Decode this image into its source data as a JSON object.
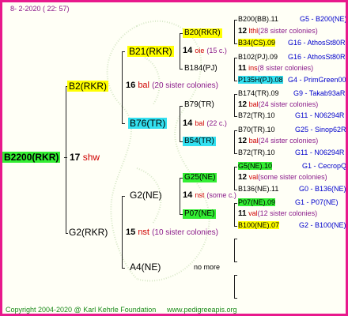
{
  "header": {
    "date": "8-  2-2020 ( 22: 57)"
  },
  "root": {
    "label": "B2200(RKR)",
    "count": "17",
    "place": "shw"
  },
  "gen1": {
    "top": {
      "label": "B2(RKR)",
      "count": "16",
      "place": "bal",
      "sister": "(20 sister colonies)"
    },
    "bottom": {
      "label": "G2(RKR)",
      "count": "15",
      "place": "nst",
      "sister": "(10 sister colonies)"
    }
  },
  "gen2": {
    "b21": {
      "label": "B21(RKR)",
      "count": "14",
      "place": "oie",
      "sister": "(15 c.)"
    },
    "b76": {
      "label": "B76(TR)",
      "count": "14",
      "place": "bal",
      "sister": "(22 c.)"
    },
    "g2": {
      "label": "G2(NE)",
      "count": "14",
      "place": "nst",
      "sister": "(some c.)"
    },
    "a4": {
      "label": "A4(NE)",
      "nomore": "no more"
    }
  },
  "gen3": {
    "b20": "B20(RKR)",
    "b184": "B184(PJ)",
    "b79": "B79(TR)",
    "b54": "B54(TR)",
    "g25": "G25(NE)",
    "p07": "P07(NE)"
  },
  "gen4": {
    "r1": {
      "name": "B200(BB).11",
      "id": "G5 - B200(NE)"
    },
    "r2": {
      "count": "12",
      "place": "lthl",
      "sister": "(28 sister colonies)"
    },
    "r3": {
      "name": "B34(CS).09",
      "id": "G16 - AthosSt80R"
    },
    "r4": {
      "name": "B102(PJ).09",
      "id": "G16 - AthosSt80R"
    },
    "r5": {
      "count": "11",
      "place": "ins",
      "sister": "(8 sister colonies)"
    },
    "r6": {
      "name": "P135H(PJ).08",
      "id": "G4 - PrimGreen00"
    },
    "r7": {
      "name": "B174(TR).09",
      "id": "G9 - Takab93aR"
    },
    "r8": {
      "count": "12",
      "place": "bal",
      "sister": "(24 sister colonies)"
    },
    "r9": {
      "name": "B72(TR).10",
      "id": "G11 - N06294R"
    },
    "r10": {
      "name": "B70(TR).10",
      "id": "G25 - Sinop62R"
    },
    "r11": {
      "count": "12",
      "place": "bal",
      "sister": "(24 sister colonies)"
    },
    "r12": {
      "name": "B72(TR).10",
      "id": "G11 - N06294R"
    },
    "r13": {
      "name": "G5(NE).10",
      "id": "G1 - CecropQ"
    },
    "r14": {
      "count": "12",
      "place": "val",
      "sister": "(some sister colonies)"
    },
    "r15": {
      "name": "B136(NE).11",
      "id": "G0 - B136(NE)"
    },
    "r16": {
      "name": "P07(NE).09",
      "id": "G1 - P07(NE)"
    },
    "r17": {
      "count": "11",
      "place": "val",
      "sister": "(12 sister colonies)"
    },
    "r18": {
      "name": "B100(NE).07",
      "id": "G2 - B100(NE)"
    }
  },
  "footer": {
    "copyright": "Copyright 2004-2020 @ Karl Kehrle Foundation",
    "url": "www.pedigreeapis.org"
  }
}
